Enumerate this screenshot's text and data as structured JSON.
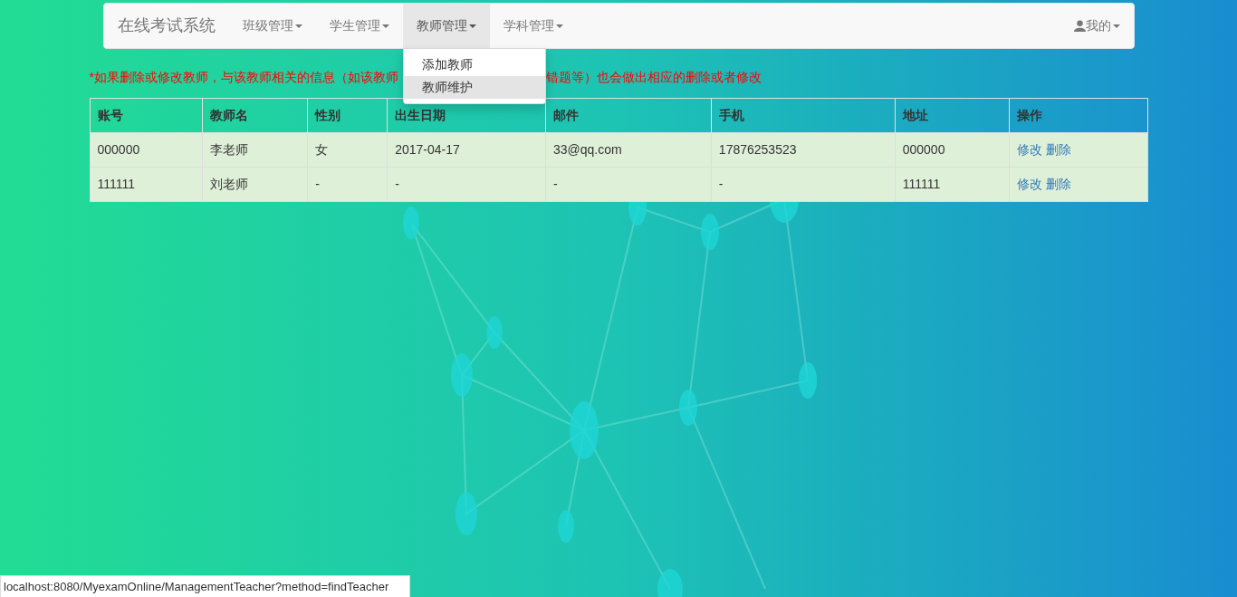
{
  "navbar": {
    "brand": "在线考试系统",
    "menus": [
      {
        "label": "班级管理",
        "selected": false
      },
      {
        "label": "学生管理",
        "selected": false
      },
      {
        "label": "教师管理",
        "selected": true
      },
      {
        "label": "学科管理",
        "selected": false
      }
    ],
    "user_menu": {
      "label": "我的"
    }
  },
  "dropdown": {
    "items": [
      {
        "label": "添加教师",
        "selected": false
      },
      {
        "label": "教师维护",
        "selected": true
      }
    ]
  },
  "notice": [
    "*如果删除或修改教师，与该教师相关的信息（如该教师",
    "错题等）也会做出相应的删除或者修改"
  ],
  "table": {
    "columns": [
      "账号",
      "教师名",
      "性别",
      "出生日期",
      "邮件",
      "手机",
      "地址",
      "操作"
    ],
    "rows": [
      {
        "cells": [
          "000000",
          "李老师",
          "女",
          "2017-04-17",
          "33@qq.com",
          "17876253523",
          "000000"
        ],
        "actions": [
          "修改",
          "删除"
        ]
      },
      {
        "cells": [
          "111111",
          "刘老师",
          "-",
          "-",
          "-",
          "-",
          "111111"
        ],
        "actions": [
          "修改",
          "删除"
        ]
      }
    ]
  },
  "status_bar": "localhost:8080/MyexamOnline/ManagementTeacher?method=findTeacher"
}
